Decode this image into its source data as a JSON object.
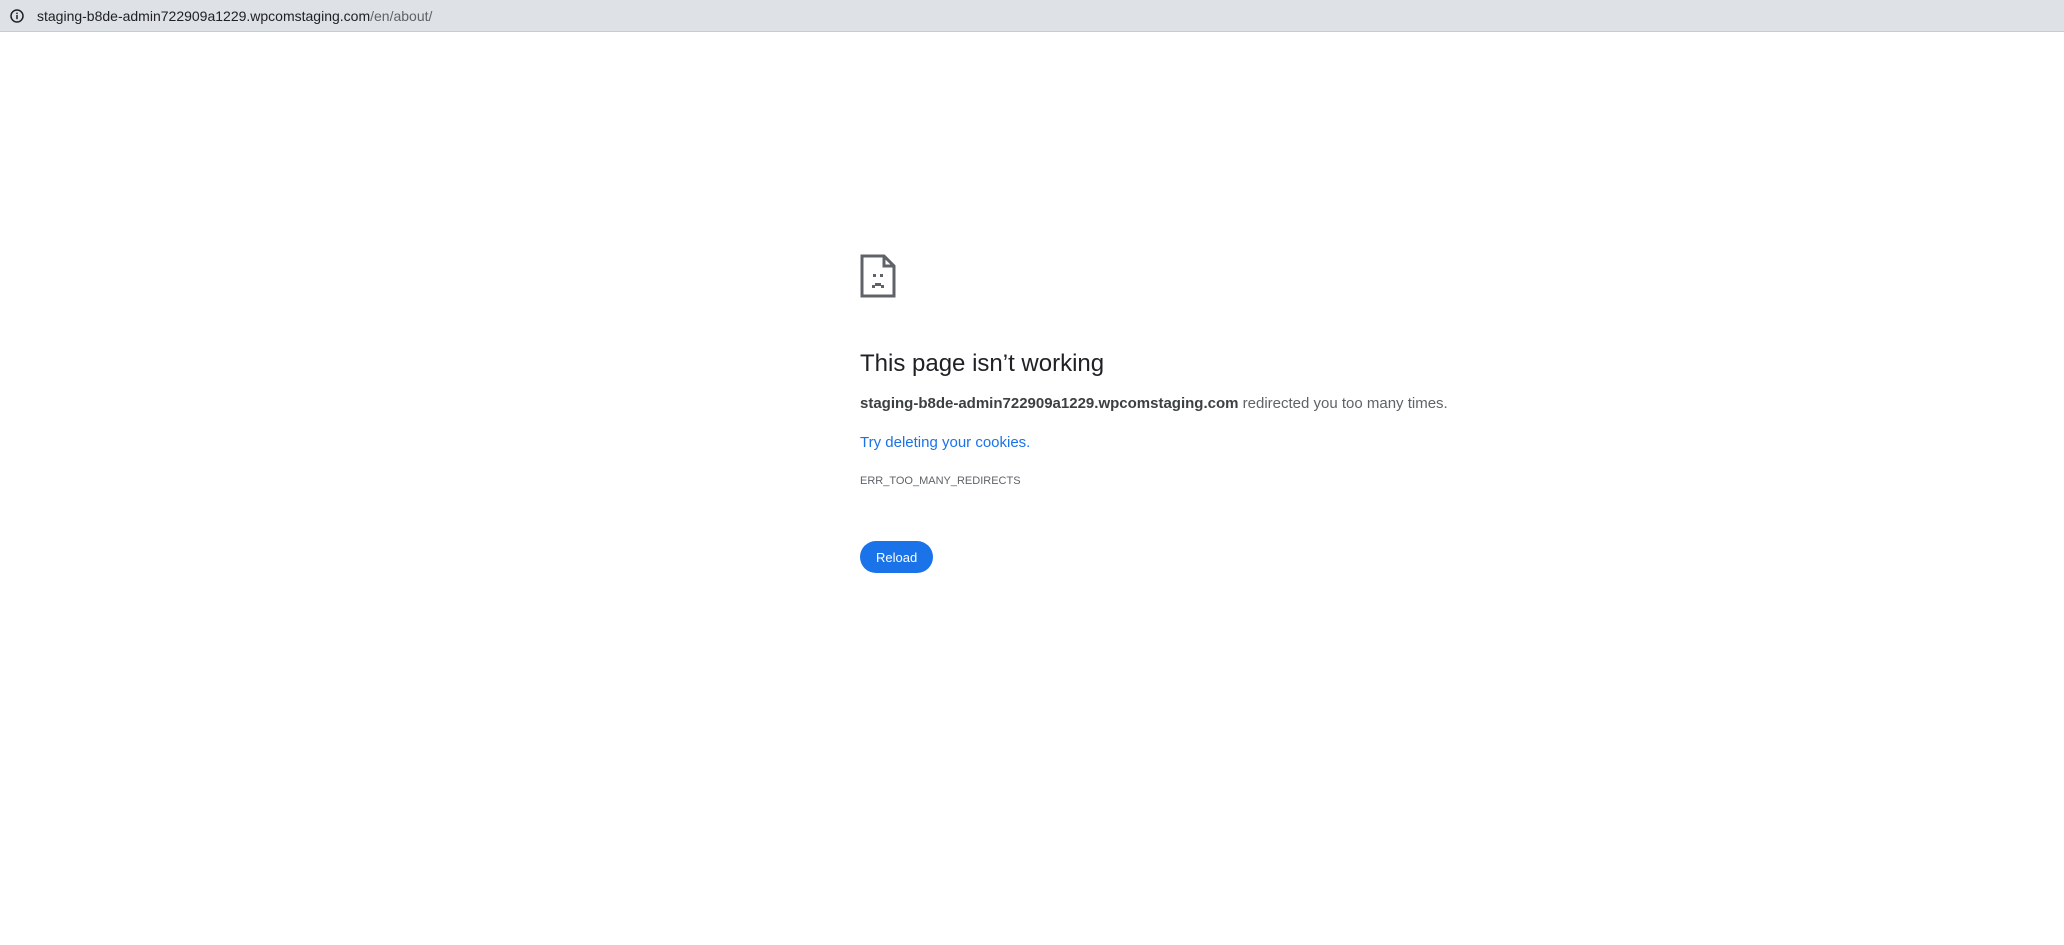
{
  "browser": {
    "url_host": "staging-b8de-admin722909a1229.wpcomstaging.com",
    "url_path": "/en/about/",
    "site_info_icon": "info-circle-icon"
  },
  "error_page": {
    "icon": "sad-page-icon",
    "title": "This page isn’t working",
    "message_host": "staging-b8de-admin722909a1229.wpcomstaging.com",
    "message_suffix": " redirected you too many times.",
    "suggestion_link": "Try deleting your cookies.",
    "error_code": "ERR_TOO_MANY_REDIRECTS",
    "reload_label": "Reload"
  },
  "colors": {
    "accent": "#1a73e8",
    "toolbar": "#dee1e6",
    "text": "#202124"
  }
}
